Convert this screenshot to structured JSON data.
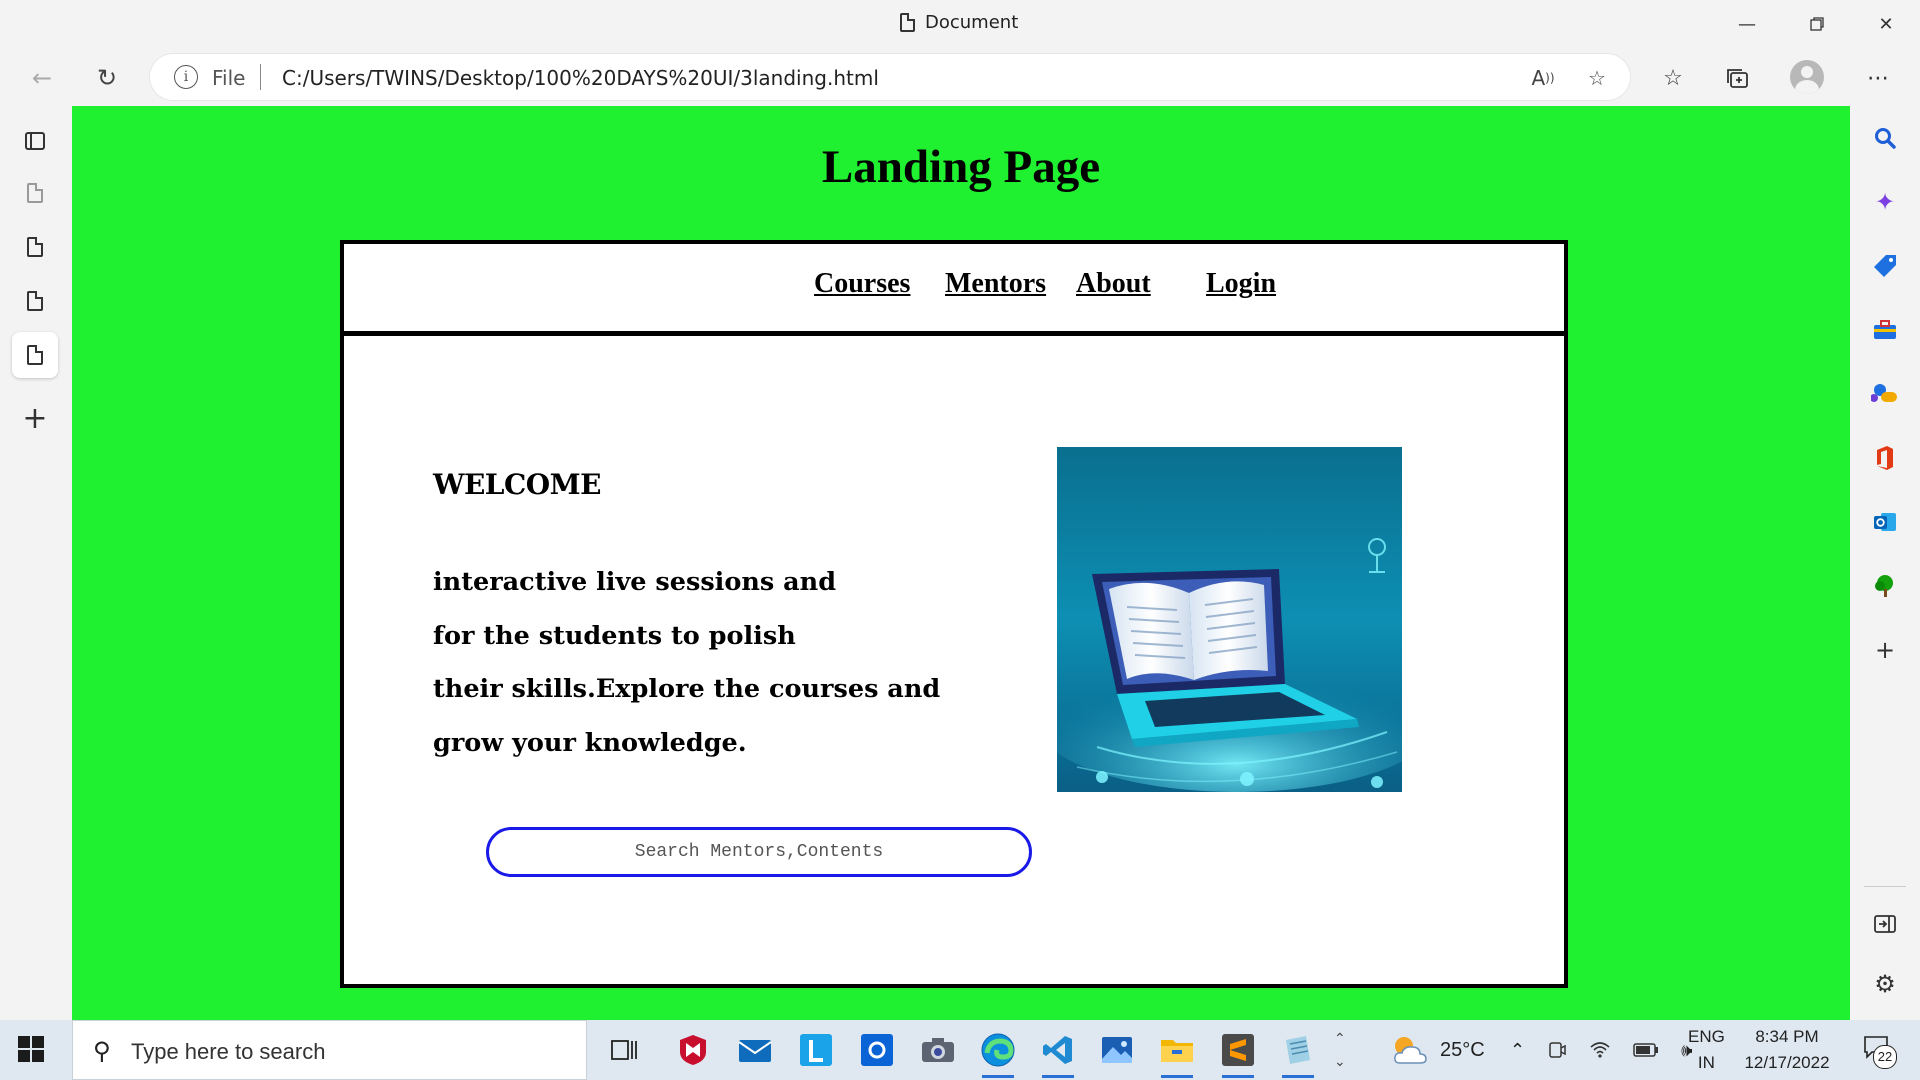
{
  "window": {
    "title": "Document",
    "controls": [
      "minimize-icon",
      "restore-icon",
      "close-icon"
    ]
  },
  "address_bar": {
    "scheme_label": "File",
    "url": "C:/Users/TWINS/Desktop/100%20DAYS%20UI/3landing.html"
  },
  "page": {
    "title": "Landing Page",
    "nav": {
      "courses": "Courses",
      "mentors": "Mentors",
      "about": "About",
      "login": "Login"
    },
    "welcome": "WELCOME",
    "paragraph_lines": [
      "interactive live sessions and",
      "for the students to polish",
      "their skills.Explore the courses and",
      "grow your knowledge."
    ],
    "search_placeholder": "Search Mentors,Contents",
    "hero_image": "laptop-book-illustration",
    "colors": {
      "page_background": "#1ff030",
      "search_border": "#1a1ae8",
      "card_background": "#ffffff"
    }
  },
  "taskbar": {
    "search_placeholder": "Type here to search",
    "weather": "25°C",
    "language_top": "ENG",
    "language_bottom": "IN",
    "time": "8:34 PM",
    "date": "12/17/2022",
    "notification_count": "22"
  }
}
